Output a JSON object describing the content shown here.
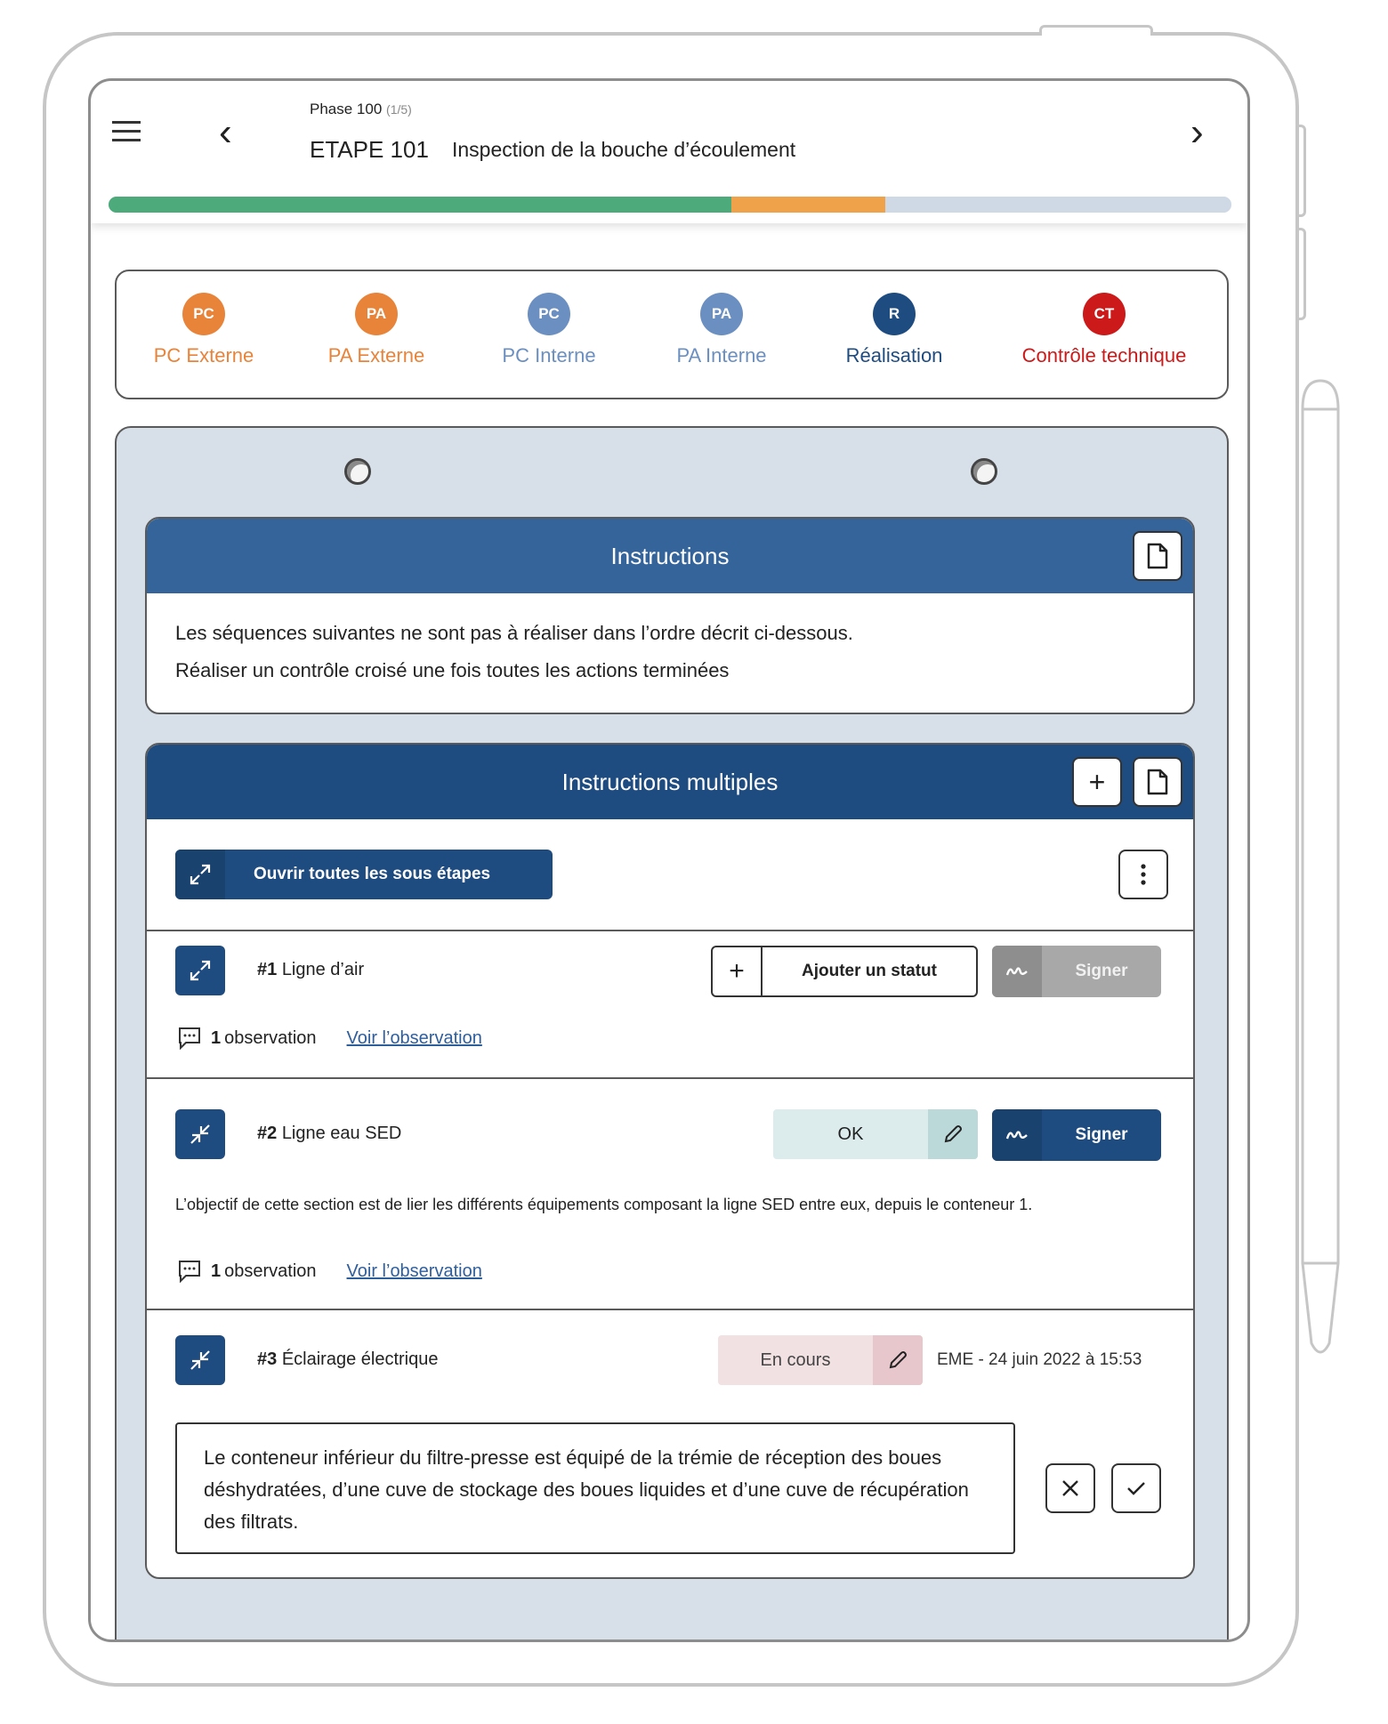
{
  "header": {
    "phase_label": "Phase 100",
    "phase_count": "(1/5)",
    "step_code": "ETAPE 101",
    "step_title": "Inspection de la bouche d’écoulement"
  },
  "progress": {
    "segments": [
      {
        "fraction": 0.555,
        "color": "#4caa7b"
      },
      {
        "fraction": 0.137,
        "color": "#f0a24a"
      },
      {
        "fraction": 0.308,
        "color": "#cfd9e6"
      }
    ]
  },
  "roles": [
    {
      "abbr": "PC",
      "label": "PC Externe",
      "color": "#e8843a"
    },
    {
      "abbr": "PA",
      "label": "PA Externe",
      "color": "#e8843a"
    },
    {
      "abbr": "PC",
      "label": "PC Interne",
      "color": "#6b8fc0"
    },
    {
      "abbr": "PA",
      "label": "PA Interne",
      "color": "#6b8fc0"
    },
    {
      "abbr": "R",
      "label": "Réalisation",
      "color": "#1f4c80"
    },
    {
      "abbr": "CT",
      "label": "Contrôle technique",
      "color": "#cc1a1a"
    }
  ],
  "instructions": {
    "title": "Instructions",
    "line1": "Les séquences suivantes ne sont pas à réaliser dans l’ordre décrit ci-dessous.",
    "line2": "Réaliser un contrôle croisé une fois toutes les actions terminées"
  },
  "multi": {
    "title": "Instructions multiples",
    "open_all_label": "Ouvrir toutes les sous étapes",
    "items": [
      {
        "num": "#1",
        "name": "Ligne d’air",
        "add_status_label": "Ajouter un statut",
        "sign_label": "Signer",
        "obs_count": "1",
        "obs_text": "observation",
        "obs_link": "Voir l’observation"
      },
      {
        "num": "#2",
        "name": "Ligne eau SED",
        "status": "OK",
        "sign_label": "Signer",
        "description": "L’objectif de cette section est de lier les différents équipements composant la ligne SED entre eux, depuis le conteneur 1.",
        "obs_count": "1",
        "obs_text": "observation",
        "obs_link": "Voir l’observation"
      },
      {
        "num": "#3",
        "name": "Éclairage électrique",
        "status": "En cours",
        "meta": "EME - 24 juin 2022 à 15:53",
        "comment": "Le conteneur inférieur du filtre-presse est équipé de la trémie de réception des boues déshydratées, d’une cuve de stockage des boues liquides et d’une cuve de récupération des filtrats."
      }
    ]
  }
}
